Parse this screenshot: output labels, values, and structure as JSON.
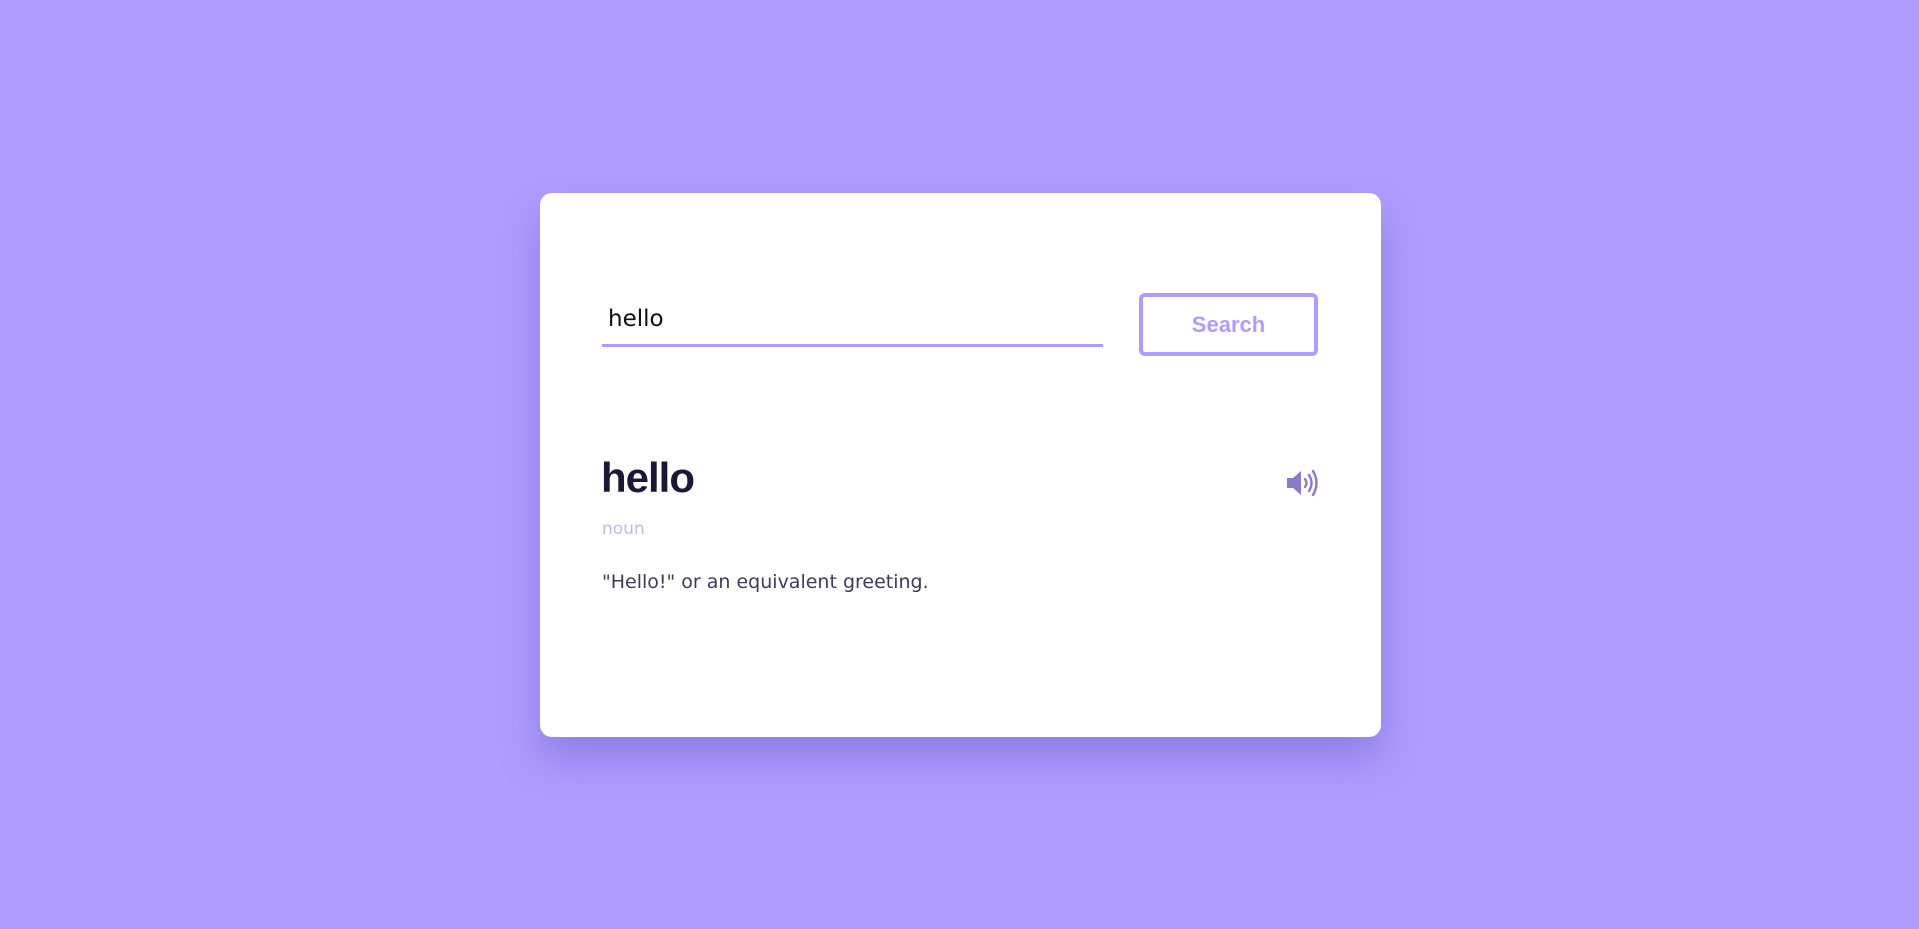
{
  "search": {
    "value": "hello",
    "button_label": "Search"
  },
  "result": {
    "word": "hello",
    "part_of_speech": "noun",
    "definition": "\"Hello!\" or an equivalent greeting."
  },
  "icons": {
    "pronunciation": "speaker-volume-icon"
  },
  "colors": {
    "background": "#ae9dfe",
    "card": "#ffffff",
    "accent": "#ae9dfe",
    "word_text": "#1e1636",
    "muted_text": "#c2b8ee",
    "icon": "#8a7bc8"
  }
}
